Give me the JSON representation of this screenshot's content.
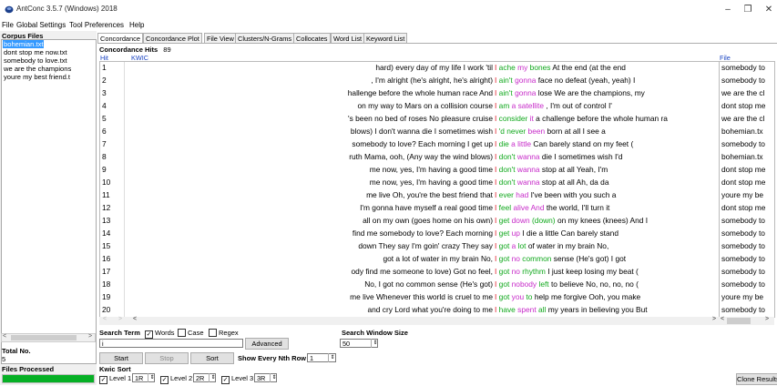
{
  "window": {
    "title": "AntConc 3.5.7 (Windows) 2018",
    "minimize": "–",
    "maximize": "❐",
    "close": "✕"
  },
  "menu": [
    "File",
    "Global Settings",
    "Tool Preferences",
    "Help"
  ],
  "corpus": {
    "title": "Corpus Files",
    "files": [
      "bohemian.txt",
      "dont stop me now.txt",
      "somebody to love.txt",
      "we are the champions",
      "youre my best friend.t"
    ],
    "total_label": "Total No.",
    "total_value": "5",
    "processed_label": "Files Processed"
  },
  "tabs": [
    "Concordance",
    "Concordance Plot",
    "File View",
    "Clusters/N-Grams",
    "Collocates",
    "Word List",
    "Keyword List"
  ],
  "hits": {
    "label": "Concordance Hits",
    "value": "89"
  },
  "columns": {
    "hit": "Hit",
    "kwic": "KWIC",
    "file": "File"
  },
  "rows": [
    {
      "n": "1",
      "left": "hard) every day of my life I work 'til",
      "kw": "I",
      "w1": "ache",
      "w2": "my",
      "w3": "bones",
      "rest": "At the end (at the end",
      "file": "somebody to"
    },
    {
      "n": "2",
      "left": ", I'm alright (he's alright, he's alright)",
      "kw": "I",
      "w1": "ain't",
      "w2": "gonna",
      "w3": "",
      "rest": "face no defeat (yeah, yeah) I",
      "file": "somebody to"
    },
    {
      "n": "3",
      "left": "hallenge before the whole human race And",
      "kw": "I",
      "w1": "ain't",
      "w2": "gonna",
      "w3": "",
      "rest": "lose We are the champions, my",
      "file": "we are the cl"
    },
    {
      "n": "4",
      "left": "on my way to Mars on a collision course",
      "kw": "I",
      "w1": "am",
      "w2": "a satellite",
      "w3": "",
      "rest": ", I'm out of control I'",
      "file": "dont stop me"
    },
    {
      "n": "5",
      "left": "'s been no bed of roses No pleasure cruise",
      "kw": "I",
      "w1": "consider",
      "w2": "it",
      "w3": "",
      "rest": "a challenge before the whole human ra",
      "file": "we are the cl"
    },
    {
      "n": "6",
      "left": "blows) I don't wanna die I sometimes wish",
      "kw": "I",
      "w1": "'d never",
      "w2": "been",
      "w3": "",
      "rest": "born at all   I see a",
      "file": "bohemian.tx"
    },
    {
      "n": "7",
      "left": "somebody to love?   Each morning I get up",
      "kw": "I",
      "w1": "die",
      "w2": "a little",
      "w3": "",
      "rest": "Can barely stand on my feet (",
      "file": "somebody to"
    },
    {
      "n": "8",
      "left": "ruth Mama, ooh, (Any way the wind blows)",
      "kw": "I",
      "w1": "don't",
      "w2": "wanna",
      "w3": "",
      "rest": "die I sometimes wish I'd",
      "file": "bohemian.tx"
    },
    {
      "n": "9",
      "left": "me now, yes, I'm having a good time",
      "kw": "I",
      "w1": "don't",
      "w2": "wanna",
      "w3": "",
      "rest": "stop at all   Yeah, I'm",
      "file": "dont stop me"
    },
    {
      "n": "10",
      "left": "me now, yes, I'm having a good time",
      "kw": "I",
      "w1": "don't",
      "w2": "wanna",
      "w3": "",
      "rest": "stop at all   Ah, da da",
      "file": "dont stop me"
    },
    {
      "n": "11",
      "left": "me live Oh, you're the best friend that",
      "kw": "I",
      "w1": "ever",
      "w2": "had",
      "w3": "",
      "rest": "I've been with you such a",
      "file": "youre my be"
    },
    {
      "n": "12",
      "left": "I'm gonna have myself a real good time",
      "kw": "I",
      "w1": "feel",
      "w2": "alive And",
      "w3": "",
      "rest": "the world, I'll turn it",
      "file": "dont stop me"
    },
    {
      "n": "13",
      "left": "all on my own (goes home on his own)",
      "kw": "I",
      "w1": "get",
      "w2": "down",
      "w3": "(down)",
      "rest": "on my knees (knees) And I",
      "file": "somebody to"
    },
    {
      "n": "14",
      "left": "find me somebody to love?   Each morning",
      "kw": "I",
      "w1": "get",
      "w2": "up",
      "w3": "",
      "rest": "I die a little Can barely stand",
      "file": "somebody to"
    },
    {
      "n": "15",
      "left": "down They say I'm goin' crazy They say",
      "kw": "I",
      "w1": "got",
      "w2": "a",
      "w3": "lot",
      "rest": "of water in my brain No,",
      "file": "somebody to"
    },
    {
      "n": "16",
      "left": "got a lot of water in my brain No,",
      "kw": "I",
      "w1": "got",
      "w2": "no",
      "w3": "common",
      "rest": "sense (He's got) I got",
      "file": "somebody to"
    },
    {
      "n": "17",
      "left": "ody find me someone to love)   Got no feel,",
      "kw": "I",
      "w1": "got",
      "w2": "no",
      "w3": "rhythm",
      "rest": "I just keep losing my beat (",
      "file": "somebody to"
    },
    {
      "n": "18",
      "left": "No, I got no common sense (He's got)",
      "kw": "I",
      "w1": "got",
      "w2": "nobody",
      "w3": "left",
      "rest": "to believe No, no, no, no   (",
      "file": "somebody to"
    },
    {
      "n": "19",
      "left": "me live Whenever this world is cruel to me",
      "kw": "I",
      "w1": "got",
      "w2": "you",
      "w3": "to",
      "rest": "help me forgive Ooh, you make",
      "file": "youre my be"
    },
    {
      "n": "20",
      "left": "and cry Lord what you're doing to me",
      "kw": "I",
      "w1": "have",
      "w2": "spent",
      "w3": "all",
      "rest": "my years in believing you But",
      "file": "somebody to"
    }
  ],
  "search": {
    "term_label": "Search Term",
    "words_label": "Words",
    "case_label": "Case",
    "regex_label": "Regex",
    "term_value": "i",
    "advanced": "Advanced",
    "window_label": "Search Window Size",
    "window_value": "50",
    "start": "Start",
    "stop": "Stop",
    "sort": "Sort",
    "nth_label": "Show Every Nth Row",
    "nth_value": "1",
    "kwic_sort": "Kwic Sort",
    "level1_label": "Level 1",
    "level1_value": "1R",
    "level2_label": "Level 2",
    "level2_value": "2R",
    "level3_label": "Level 3",
    "level3_value": "3R",
    "clone": "Clone Results"
  },
  "colors": {
    "keyword": "#e0202a",
    "collocate1": "#10a81c",
    "collocate2": "#c72bc9",
    "selection": "#3399ff",
    "progress": "#06b025"
  },
  "progress_fraction": 1.0
}
